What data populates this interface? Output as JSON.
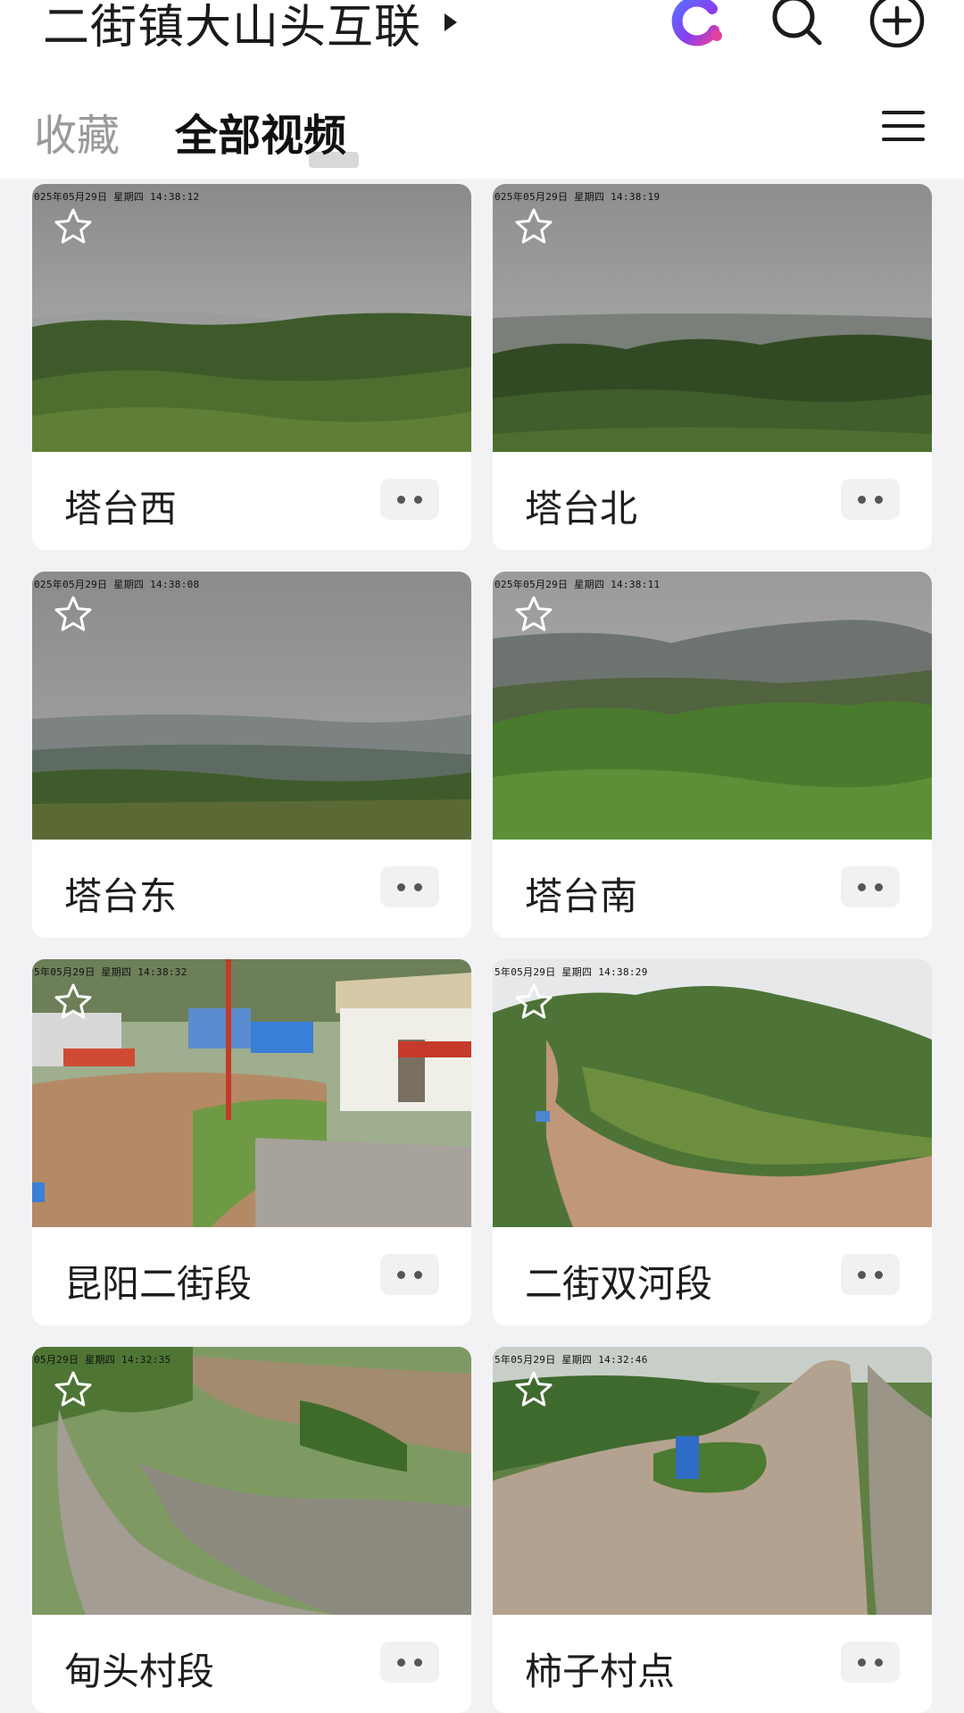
{
  "header": {
    "title": "二街镇大山头互联",
    "icons": [
      "assistant-logo-icon",
      "search-icon",
      "add-icon"
    ]
  },
  "tabs": [
    {
      "label": "收藏",
      "active": false
    },
    {
      "label": "全部视频",
      "active": true
    }
  ],
  "cameras": [
    {
      "name": "塔台西",
      "osd": "025年05月29日  星期四  14:38:12",
      "favorite": false
    },
    {
      "name": "塔台北",
      "osd": "025年05月29日  星期四  14:38:19",
      "favorite": false
    },
    {
      "name": "塔台东",
      "osd": "025年05月29日  星期四  14:38:08",
      "favorite": false
    },
    {
      "name": "塔台南",
      "osd": "025年05月29日  星期四  14:38:11",
      "favorite": false
    },
    {
      "name": "昆阳二街段",
      "osd": "5年05月29日  星期四  14:38:32",
      "favorite": false
    },
    {
      "name": "二街双河段",
      "osd": "5年05月29日  星期四  14:38:29",
      "favorite": false
    },
    {
      "name": "甸头村段",
      "osd": "05月29日  星期四  14:32:35",
      "favorite": false
    },
    {
      "name": "柿子村点",
      "osd": "5年05月29日  星期四  14:32:46",
      "favorite": false
    }
  ],
  "colors": {
    "background": "#f2f2f5",
    "card": "#ffffff",
    "logo_purple": "#7b3ff2",
    "logo_pink": "#e040a0"
  }
}
